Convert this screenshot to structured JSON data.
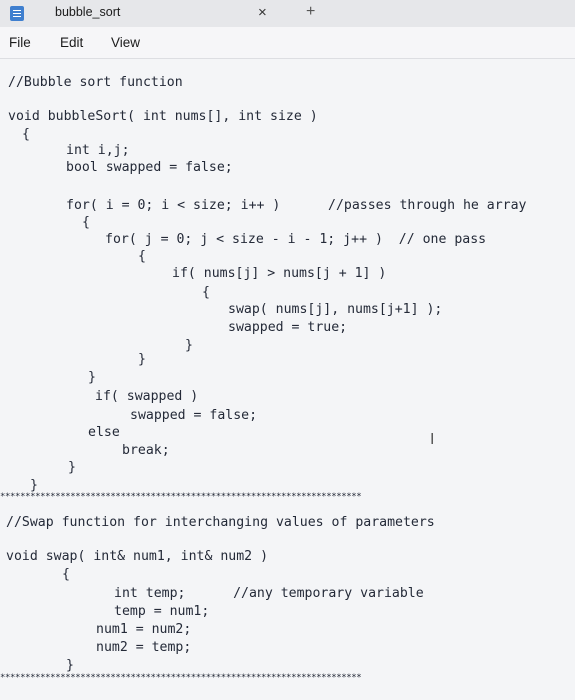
{
  "window": {
    "tab_title": "bubble_sort",
    "close_glyph": "×",
    "new_tab_glyph": "+"
  },
  "menu": [
    "File",
    "Edit",
    "View"
  ],
  "editor": {
    "lines": [
      "//Bubble sort function",
      "void bubbleSort( int nums[], int size )",
      "{",
      "int i,j;",
      "bool swapped = false;",
      "for( i = 0; i < size; i++ )      //passes through he array",
      "{",
      "for( j = 0; j < size - i - 1; j++ )  // one pass",
      "{",
      "if( nums[j] > nums[j + 1] )",
      "{",
      "swap( nums[j], nums[j+1] );",
      "swapped = true;",
      "}",
      "}",
      "}",
      "if( swapped )",
      "swapped = false;",
      "else",
      "break;",
      "}",
      "}",
      "************************************************************************",
      "//Swap function for interchanging values of parameters",
      "void swap( int& num1, int& num2 )",
      "{",
      "int temp;      //any temporary variable",
      "temp = num1;",
      "num1 = num2;",
      "num2 = temp;",
      "}",
      "************************************************************************"
    ]
  },
  "icons": {
    "app": "notepad-icon",
    "cursor": "text-cursor-icon"
  }
}
